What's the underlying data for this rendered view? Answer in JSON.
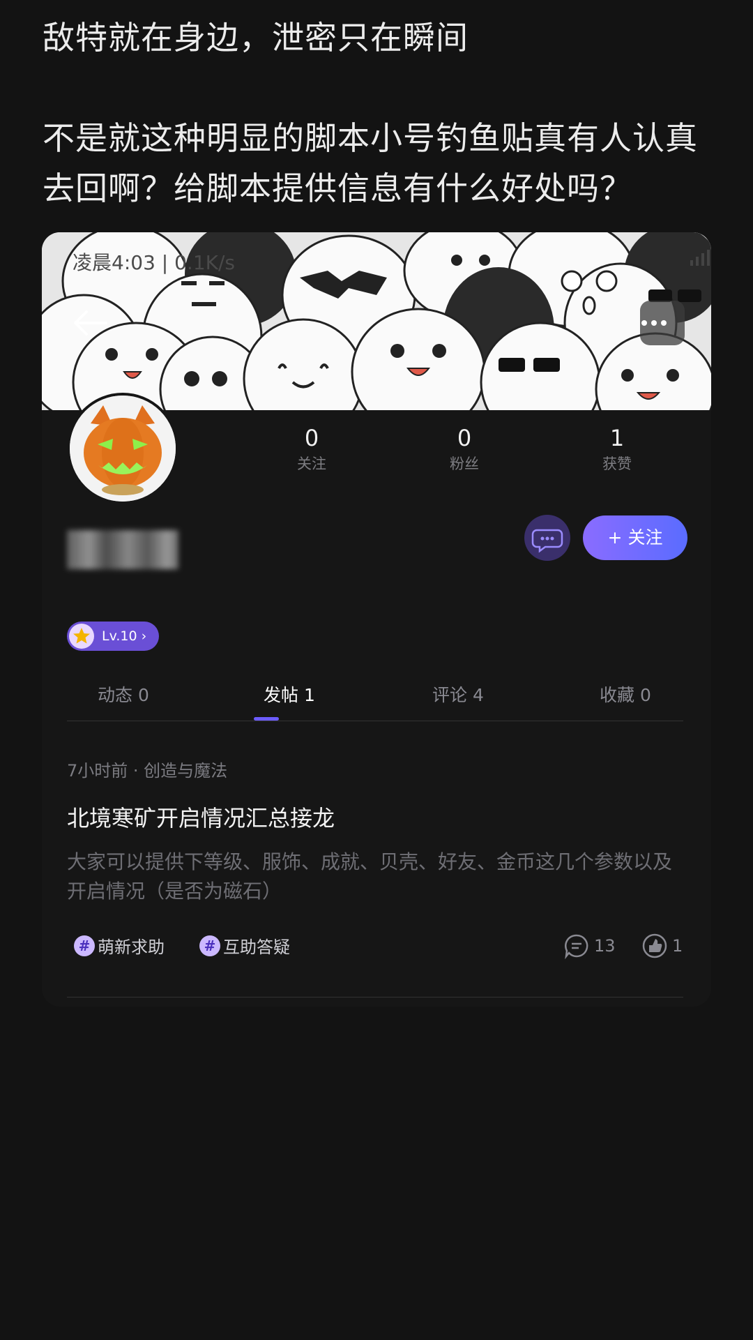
{
  "post": {
    "line1": "敌特就在身边，泄密只在瞬间",
    "line2": "不是就这种明显的脚本小号钓鱼贴真有人认真去回啊？给脚本提供信息有什么好处吗？"
  },
  "screenshot": {
    "status": {
      "time_text": "凌晨4:03 | 0.1K/s"
    },
    "profile": {
      "stats": [
        {
          "value": "0",
          "label": "关注"
        },
        {
          "value": "0",
          "label": "粉丝"
        },
        {
          "value": "1",
          "label": "获赞"
        }
      ],
      "follow_label": "+ 关注",
      "level_label": "Lv.10 ›"
    },
    "tabs": [
      {
        "label": "动态 0"
      },
      {
        "label": "发帖 1"
      },
      {
        "label": "评论 4"
      },
      {
        "label": "收藏 0"
      }
    ],
    "active_tab": 1,
    "post": {
      "meta": "7小时前 · 创造与魔法",
      "title": "北境寒矿开启情况汇总接龙",
      "body": "大家可以提供下等级、服饰、成就、贝壳、好友、金币这几个参数以及开启情况（是否为磁石）",
      "tags": [
        {
          "label": "萌新求助"
        },
        {
          "label": "互助答疑"
        }
      ],
      "comment_count": "13",
      "like_count": "1"
    }
  },
  "colors": {
    "background": "#131313",
    "accent": "#6c5cff",
    "follow_gradient_start": "#8a6cff",
    "follow_gradient_end": "#5a6cff"
  }
}
